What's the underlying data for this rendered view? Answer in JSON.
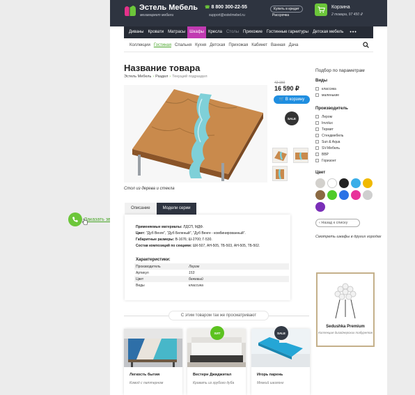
{
  "float_widget": {
    "text": "Заказать звонок"
  },
  "header": {
    "logo_title": "Эстель Мебель",
    "logo_sub": "мегамаркет мебели",
    "phone": "8 800 300-22-55",
    "email": "support@estelmebel.ru",
    "credit_button": "Купить в кредит",
    "installment": "Рассрочка",
    "cart_title": "Корзина",
    "cart_info": "2 товара, 97 450 ₽"
  },
  "nav": {
    "items": [
      "Диваны",
      "Кровати",
      "Матрасы",
      "Шкафы",
      "Кресла",
      "Столы",
      "Прихожие",
      "Гостинные гарнитуры",
      "Детская мебель"
    ],
    "more": "•••"
  },
  "subnav": {
    "items": [
      "Коллекции",
      "Гостиная",
      "Спальня",
      "Кухня",
      "Детская",
      "Прихожая",
      "Кабинет",
      "Ванная",
      "Дача"
    ]
  },
  "product": {
    "title": "Название товара",
    "breadcrumbs": [
      "Эстель Мебель",
      "Раздел",
      "Текущий подраздел"
    ],
    "old_price": "42 150",
    "price": "16 590 ₽",
    "buy_button": "В корзину",
    "sale_badge": "SALE",
    "caption": "Стол из дерева и стекла",
    "tabs": [
      "Описание",
      "Модели серии"
    ],
    "description": [
      {
        "k": "Применяемые материалы:",
        "v": "ЛДСП, МДФ."
      },
      {
        "k": "Цвет:",
        "v": "\"Дуб Венге\", \"Дуб Беленый\", \"Дуб Венге - комбинированный\"."
      },
      {
        "k": "Габаритные размеры:",
        "v": "В-1676; Ш-2700; Г-530."
      },
      {
        "k": "Состав композиций по секциям:",
        "v": "ШК-507, АН-505, ТБ-503, АН-505, ТБ-502."
      }
    ],
    "char_title": "Характеристики:",
    "chars": [
      {
        "k": "Производитель",
        "v": "Лером"
      },
      {
        "k": "Артикул",
        "v": "153"
      },
      {
        "k": "Цвет",
        "v": "бежевый"
      },
      {
        "k": "Виды",
        "v": "классика"
      }
    ]
  },
  "also_viewed": {
    "title": "С этим товаром так же просматривают",
    "cards": [
      {
        "name": "Легкость бытия",
        "sub": "Комод с паттерном"
      },
      {
        "name": "Вестерн Джиджитал",
        "sub": "Кровать из грубого дуба",
        "badge": "ХИТ"
      },
      {
        "name": "Игорь парень",
        "sub": "Мягкий шезлонг",
        "badge": "SALE"
      }
    ]
  },
  "sidebar": {
    "title": "Подбор по параметрам",
    "types_title": "Виды",
    "types": [
      "классика",
      "маленькие"
    ],
    "makers_title": "Производитель",
    "makers": [
      "Лером",
      "Involux",
      "Термит",
      "Стендмебель",
      "Sun & Aqua",
      "SV-Мебель",
      "BBP",
      "Горизонт"
    ],
    "color_title": "Цвет",
    "colors": [
      "#d3d1cd",
      "#ffffff",
      "#222222",
      "#3aaee8",
      "#f0b900",
      "#8b6a43",
      "#4fcb2b",
      "#2a72e6",
      "#e8319a",
      "#cfcfcf",
      "#7a2fb8"
    ],
    "back_button": "Назад к списку",
    "look_link": "Смотреть шкафы в других городах",
    "promo_name": "Sedushka Premium",
    "promo_sub": "Коллекция дизайнерских табуретов"
  }
}
